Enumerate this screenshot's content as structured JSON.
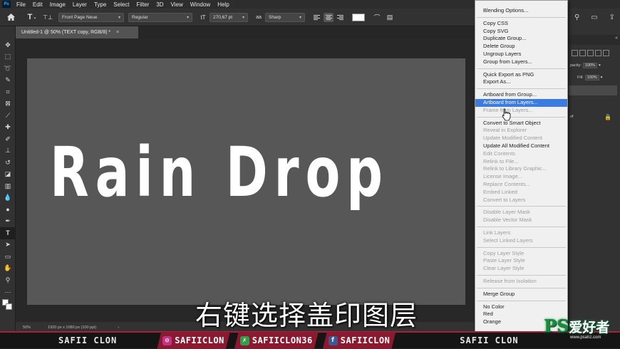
{
  "menubar": {
    "logo": "Ps",
    "items": [
      "File",
      "Edit",
      "Image",
      "Layer",
      "Type",
      "Select",
      "Filter",
      "3D",
      "View",
      "Window",
      "Help"
    ]
  },
  "options": {
    "font_family": "Front Page Neue",
    "font_style": "Regular",
    "font_size": "270,67 pt",
    "antialias": "Sharp",
    "text_color": "#ffffff"
  },
  "document": {
    "tab_title": "Untitled-1 @ 50% (TEXT copy, RGB/8) *",
    "canvas_text": "Rain Drop",
    "canvas_color": "#575757"
  },
  "status": {
    "zoom": "50%",
    "dimensions": "1920 px x 1080 px (100 ppi)"
  },
  "context_menu": {
    "items": [
      {
        "label": "Blending Options...",
        "state": "enabled"
      },
      {
        "sep": true
      },
      {
        "label": "Copy CSS",
        "state": "enabled"
      },
      {
        "label": "Copy SVG",
        "state": "enabled"
      },
      {
        "label": "Duplicate Group...",
        "state": "enabled"
      },
      {
        "label": "Delete Group",
        "state": "enabled"
      },
      {
        "label": "Ungroup Layers",
        "state": "enabled"
      },
      {
        "label": "Group from Layers...",
        "state": "enabled"
      },
      {
        "sep": true
      },
      {
        "label": "Quick Export as PNG",
        "state": "enabled"
      },
      {
        "label": "Export As...",
        "state": "enabled"
      },
      {
        "sep": true
      },
      {
        "label": "Artboard from Group...",
        "state": "enabled"
      },
      {
        "label": "Artboard from Layers...",
        "state": "hover"
      },
      {
        "label": "Frame from Layers...",
        "state": "disabled"
      },
      {
        "sep": true
      },
      {
        "label": "Convert to Smart Object",
        "state": "enabled"
      },
      {
        "label": "Reveal in Explorer",
        "state": "disabled"
      },
      {
        "label": "Update Modified Content",
        "state": "disabled"
      },
      {
        "label": "Update All Modified Content",
        "state": "enabled"
      },
      {
        "label": "Edit Contents",
        "state": "disabled"
      },
      {
        "label": "Relink to File...",
        "state": "disabled"
      },
      {
        "label": "Relink to Library Graphic...",
        "state": "disabled"
      },
      {
        "label": "License Image...",
        "state": "disabled"
      },
      {
        "label": "Replace Contents...",
        "state": "disabled"
      },
      {
        "label": "Embed Linked",
        "state": "disabled"
      },
      {
        "label": "Convert to Layers",
        "state": "disabled"
      },
      {
        "sep": true
      },
      {
        "label": "Disable Layer Mask",
        "state": "disabled"
      },
      {
        "label": "Disable Vector Mask",
        "state": "disabled"
      },
      {
        "sep": true
      },
      {
        "label": "Link Layers",
        "state": "disabled"
      },
      {
        "label": "Select Linked Layers",
        "state": "disabled"
      },
      {
        "sep": true
      },
      {
        "label": "Copy Layer Style",
        "state": "disabled"
      },
      {
        "label": "Paste Layer Style",
        "state": "disabled"
      },
      {
        "label": "Clear Layer Style",
        "state": "disabled"
      },
      {
        "sep": true
      },
      {
        "label": "Release from Isolation",
        "state": "disabled"
      },
      {
        "sep": true
      },
      {
        "label": "Merge Group",
        "state": "enabled"
      },
      {
        "sep": true
      },
      {
        "label": "No Color",
        "state": "enabled"
      },
      {
        "label": "Red",
        "state": "enabled"
      },
      {
        "label": "Orange",
        "state": "enabled"
      }
    ]
  },
  "layers_panel": {
    "opacity_label": "pacity:",
    "opacity_value": "100%",
    "fill_label": "Fill:",
    "fill_value": "100%",
    "partial_layer_text": "of"
  },
  "subtitle": "右键选择盖印图层",
  "footer": {
    "left_name": "SAFII CLON",
    "instagram": "SAFIICLON",
    "twitter": "SAFIICLON36",
    "facebook": "SAFIICLON",
    "right_name": "SAFII CLON",
    "accent": "#a8203c"
  },
  "watermark": {
    "brand": "PS",
    "text": "爱好者",
    "url": "www.psahz.com"
  }
}
